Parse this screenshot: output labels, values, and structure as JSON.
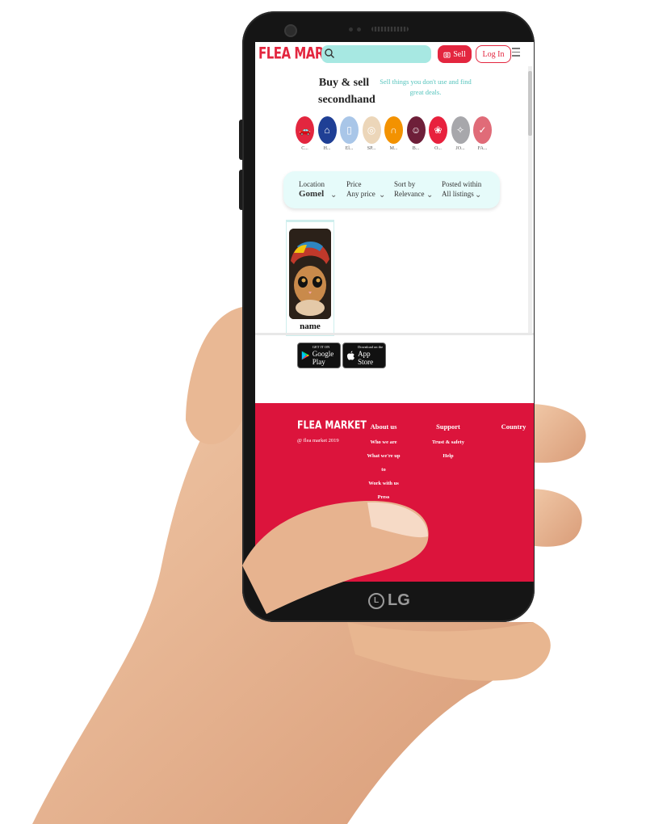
{
  "header": {
    "logo": "FLEA MARKET",
    "search_placeholder": "",
    "sell_label": "Sell",
    "login_label": "Log In"
  },
  "hero": {
    "title": "Buy & sell secondhand",
    "subtitle": "Sell things you don't use and find great deals."
  },
  "categories": [
    {
      "label": "C...",
      "icon": "car-icon",
      "color": "#e3263f"
    },
    {
      "label": "H...",
      "icon": "house-icon",
      "color": "#1f3f95"
    },
    {
      "label": "El...",
      "icon": "phone-icon",
      "color": "#a9c6e8"
    },
    {
      "label": "SP...",
      "icon": "ball-icon",
      "color": "#ecd6b9"
    },
    {
      "label": "M...",
      "icon": "headphones-icon",
      "color": "#f39200"
    },
    {
      "label": "B...",
      "icon": "baby-icon",
      "color": "#6e1f39"
    },
    {
      "label": "O...",
      "icon": "vehicle-icon",
      "color": "#e8213d"
    },
    {
      "label": "JO...",
      "icon": "handshake-icon",
      "color": "#a7a7ab"
    },
    {
      "label": "FA...",
      "icon": "heel-icon",
      "color": "#e06b78"
    }
  ],
  "filters": [
    {
      "label": "Location",
      "value": "Gomel"
    },
    {
      "label": "Price",
      "value": "Any price"
    },
    {
      "label": "Sort by",
      "value": "Relevance"
    },
    {
      "label": "Posted within",
      "value": "All listings"
    }
  ],
  "listing": {
    "name": "name"
  },
  "badges": {
    "google_small": "GET IT ON",
    "google_big": "Google Play",
    "apple_small": "Download on the",
    "apple_big": "App Store"
  },
  "footer": {
    "logo": "FLEA MARKET",
    "copyright": "@ flea market 2019",
    "about_heading": "About us",
    "about_items": [
      "Who we are",
      "What we're up to",
      "Work with us",
      "Press"
    ],
    "support_heading": "Support",
    "support_items": [
      "Trust & safety",
      "Help"
    ],
    "country_heading": "Country"
  },
  "device": {
    "brand": "LG"
  },
  "colors": {
    "brand_red": "#e3263f",
    "footer_red": "#dc143c",
    "search_teal": "#a7e8e2",
    "filter_bg": "#e6fbfa"
  }
}
